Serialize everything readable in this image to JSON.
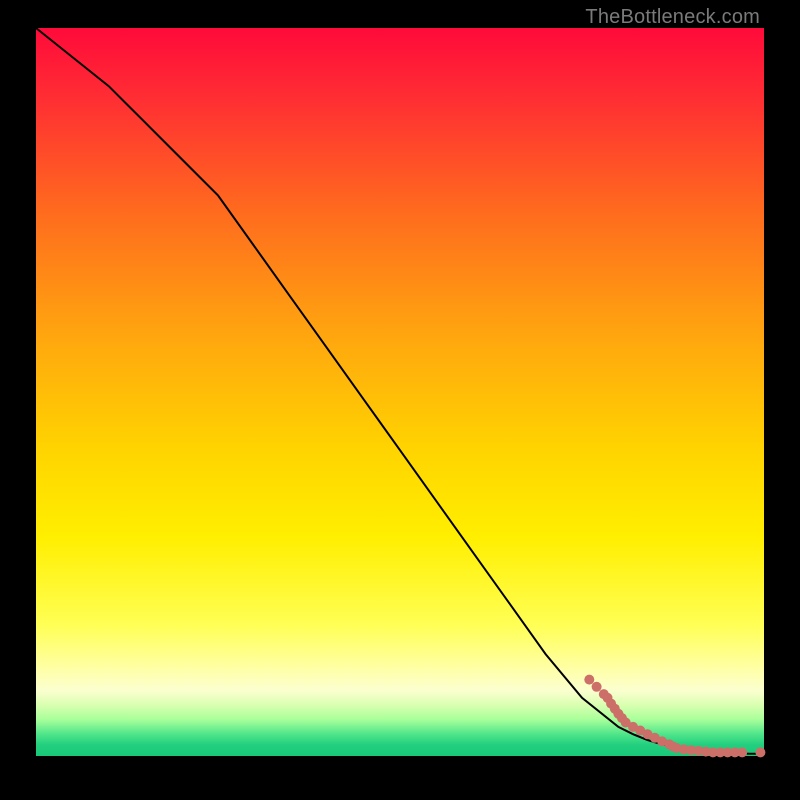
{
  "attribution": "TheBottleneck.com",
  "chart_data": {
    "type": "line",
    "title": "",
    "xlabel": "",
    "ylabel": "",
    "xlim": [
      0,
      100
    ],
    "ylim": [
      0,
      100
    ],
    "grid": false,
    "series": [
      {
        "name": "curve",
        "style": "line",
        "color": "#000000",
        "x": [
          0,
          5,
          10,
          15,
          20,
          25,
          30,
          35,
          40,
          45,
          50,
          55,
          60,
          65,
          70,
          75,
          80,
          82,
          84,
          86,
          88,
          90,
          92,
          94,
          96,
          98,
          100
        ],
        "values": [
          100,
          96,
          92,
          87,
          82,
          77,
          70,
          63,
          56,
          49,
          42,
          35,
          28,
          21,
          14,
          8,
          4,
          3,
          2.2,
          1.6,
          1.2,
          0.9,
          0.7,
          0.5,
          0.4,
          0.3,
          0.3
        ]
      },
      {
        "name": "points",
        "style": "scatter",
        "color": "#cc6f68",
        "x": [
          76,
          77,
          78,
          78.5,
          79,
          79.5,
          80,
          80.5,
          81,
          82,
          83,
          84,
          85,
          86,
          87,
          87.5,
          88,
          89,
          90,
          91,
          92,
          93,
          94,
          95,
          96,
          97,
          99.5
        ],
        "values": [
          10.5,
          9.5,
          8.5,
          8.0,
          7.2,
          6.5,
          5.8,
          5.2,
          4.6,
          4.0,
          3.5,
          3.0,
          2.5,
          2.0,
          1.6,
          1.3,
          1.1,
          0.9,
          0.8,
          0.7,
          0.6,
          0.5,
          0.5,
          0.5,
          0.5,
          0.5,
          0.5
        ]
      }
    ]
  },
  "colors": {
    "point": "#cc6f68",
    "line": "#000000",
    "frame_bg": "#000000"
  }
}
